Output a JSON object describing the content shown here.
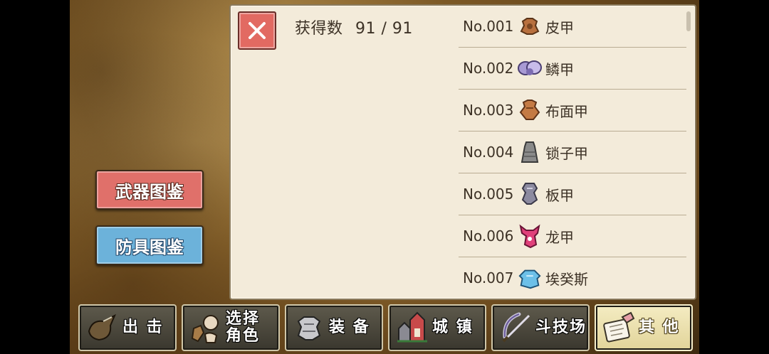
{
  "side_buttons": {
    "weapons": "武器图鉴",
    "armor": "防具图鉴"
  },
  "panel": {
    "count_label": "获得数",
    "count_value": "91 / 91",
    "items": [
      {
        "no": "No.001",
        "name": "皮甲",
        "icon": "leather-armor-icon"
      },
      {
        "no": "No.002",
        "name": "鳞甲",
        "icon": "scale-armor-icon"
      },
      {
        "no": "No.003",
        "name": "布面甲",
        "icon": "cloth-armor-icon"
      },
      {
        "no": "No.004",
        "name": "锁子甲",
        "icon": "chainmail-icon"
      },
      {
        "no": "No.005",
        "name": "板甲",
        "icon": "plate-armor-icon"
      },
      {
        "no": "No.006",
        "name": "龙甲",
        "icon": "dragon-armor-icon"
      },
      {
        "no": "No.007",
        "name": "埃癸斯",
        "icon": "aegis-icon"
      }
    ]
  },
  "nav": [
    {
      "label": "出 击",
      "icon": "sortie-icon"
    },
    {
      "label": "选择\n角色",
      "icon": "character-select-icon"
    },
    {
      "label": "装 备",
      "icon": "equipment-icon"
    },
    {
      "label": "城 镇",
      "icon": "town-icon"
    },
    {
      "label": "斗技场",
      "icon": "arena-icon"
    },
    {
      "label": "其 他",
      "icon": "other-icon"
    }
  ],
  "colors": {
    "weapon_button": "#e0706a",
    "armor_button": "#6cb2da",
    "panel_bg": "#f3ebda"
  }
}
